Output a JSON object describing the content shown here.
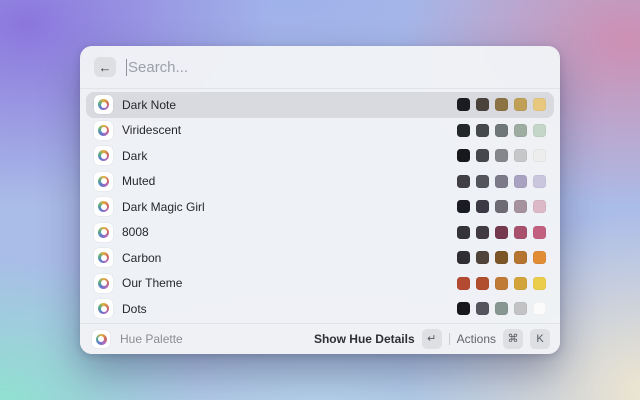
{
  "search": {
    "placeholder": "Search..."
  },
  "header": {
    "back_label": "←"
  },
  "palettes": [
    {
      "name": "Dark Note",
      "selected": true,
      "colors": [
        "#1b1b22",
        "#4a433c",
        "#8c7344",
        "#c09f56",
        "#e8c87f"
      ]
    },
    {
      "name": "Viridescent",
      "selected": false,
      "colors": [
        "#24282a",
        "#45494b",
        "#6f7779",
        "#9dada2",
        "#c3d6c7"
      ]
    },
    {
      "name": "Dark",
      "selected": false,
      "colors": [
        "#17181c",
        "#46474c",
        "#85878c",
        "#c5c7c8",
        "#ededee"
      ]
    },
    {
      "name": "Muted",
      "selected": false,
      "colors": [
        "#3f3f44",
        "#54545c",
        "#7c7a89",
        "#a9a3c1",
        "#cac6de"
      ]
    },
    {
      "name": "Dark Magic Girl",
      "selected": false,
      "colors": [
        "#1b1b23",
        "#3b3a44",
        "#6e6b74",
        "#a6919f",
        "#dcb9c6"
      ]
    },
    {
      "name": "8008",
      "selected": false,
      "colors": [
        "#333338",
        "#403a42",
        "#75394e",
        "#a8506c",
        "#c2607f"
      ]
    },
    {
      "name": "Carbon",
      "selected": false,
      "colors": [
        "#2e2e33",
        "#50443a",
        "#7b5527",
        "#b5742f",
        "#e08d36"
      ]
    },
    {
      "name": "Our Theme",
      "selected": false,
      "colors": [
        "#b54a32",
        "#b04e2d",
        "#c07b36",
        "#d2a439",
        "#eccd4a"
      ]
    },
    {
      "name": "Dots",
      "selected": false,
      "colors": [
        "#17171c",
        "#56555e",
        "#879691",
        "#c3c3c6",
        "#fbfbfc"
      ]
    }
  ],
  "footer": {
    "source_label": "Hue Palette",
    "primary_action": "Show Hue Details",
    "primary_key": "↵",
    "secondary_action": "Actions",
    "secondary_keys": [
      "⌘",
      "K"
    ]
  }
}
